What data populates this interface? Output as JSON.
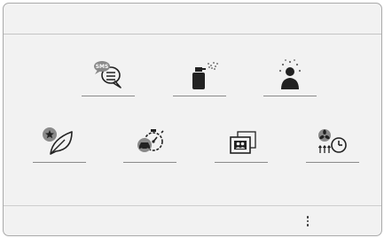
{
  "screen": {
    "top_bar_title": "",
    "bottom_bar": {
      "more_icon": "more-vertical-icon"
    }
  },
  "tiles": [
    {
      "name": "sms",
      "icon": "sms-bubble-icon",
      "badge_text": "SMS"
    },
    {
      "name": "fragrance",
      "icon": "fragrance-spray-icon"
    },
    {
      "name": "ambiance",
      "icon": "person-light-icon"
    },
    {
      "name": "eco",
      "icon": "eco-leaf-star-icon"
    },
    {
      "name": "driving-timer",
      "icon": "car-timer-icon"
    },
    {
      "name": "photos",
      "icon": "photo-album-icon"
    },
    {
      "name": "climate-programming",
      "icon": "fan-clock-icon"
    }
  ],
  "colors": {
    "background": "#f2f2f2",
    "icon": "#222222",
    "accent_gray": "#8a8a8a",
    "border": "#a9a9a9"
  }
}
